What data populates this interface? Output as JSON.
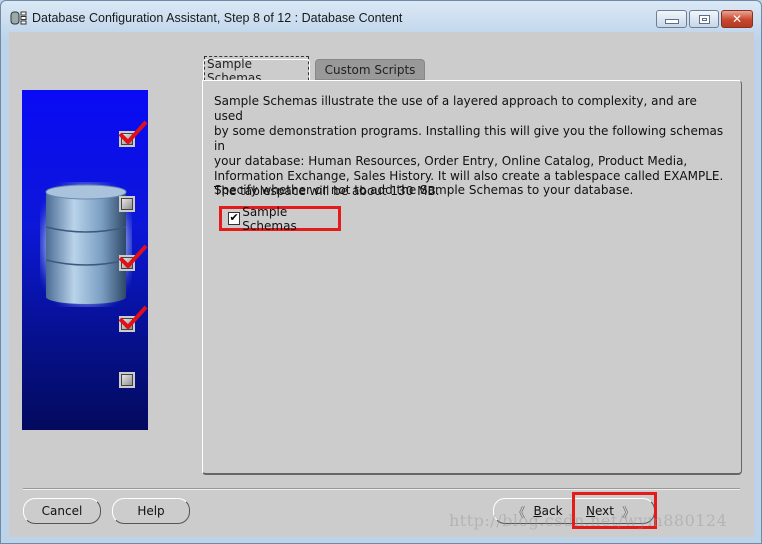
{
  "window": {
    "title": "Database Configuration Assistant, Step 8 of 12 : Database Content",
    "controls": {
      "minimize": "minimize",
      "maximize": "maximize",
      "close": "✕"
    }
  },
  "wizard_steps": [
    {
      "step": 1,
      "completed": true
    },
    {
      "step": 2,
      "completed": false
    },
    {
      "step": 3,
      "completed": true
    },
    {
      "step": 4,
      "completed": true
    },
    {
      "step": 5,
      "completed": false
    }
  ],
  "tabs": [
    {
      "label": "Sample Schemas",
      "active": true
    },
    {
      "label": "Custom Scripts",
      "active": false
    }
  ],
  "content": {
    "description": "Sample Schemas illustrate the use of a layered approach to complexity, and are used by some demonstration programs. Installing this will give you the following schemas in your database: Human Resources, Order Entry, Online Catalog, Product Media, Information Exchange, Sales History. It will also create a tablespace called EXAMPLE. The tablespace will be about 130 MB.",
    "description_lines": [
      "Sample Schemas illustrate the use of a layered approach to complexity, and are used",
      "by some demonstration programs. Installing this will give you the following schemas in",
      "your database: Human Resources, Order Entry, Online Catalog, Product Media,",
      "Information Exchange, Sales History. It will also create a tablespace called EXAMPLE.",
      "The tablespace will be about 130 MB."
    ],
    "instruction": "Specify whether or not to add the Sample Schemas to your database.",
    "checkbox": {
      "label": "Sample Schemas",
      "checked": true,
      "mark": "✔"
    }
  },
  "buttons": {
    "cancel": "Cancel",
    "help": "Help",
    "back_arrow": "《",
    "back_mnemonic": "B",
    "back_rest": "ack",
    "next_mnemonic": "N",
    "next_rest": "ext",
    "next_arrow": "》"
  },
  "highlight_color": "#e31b1b",
  "watermark": "http://blog.csdn.net/wym880124"
}
